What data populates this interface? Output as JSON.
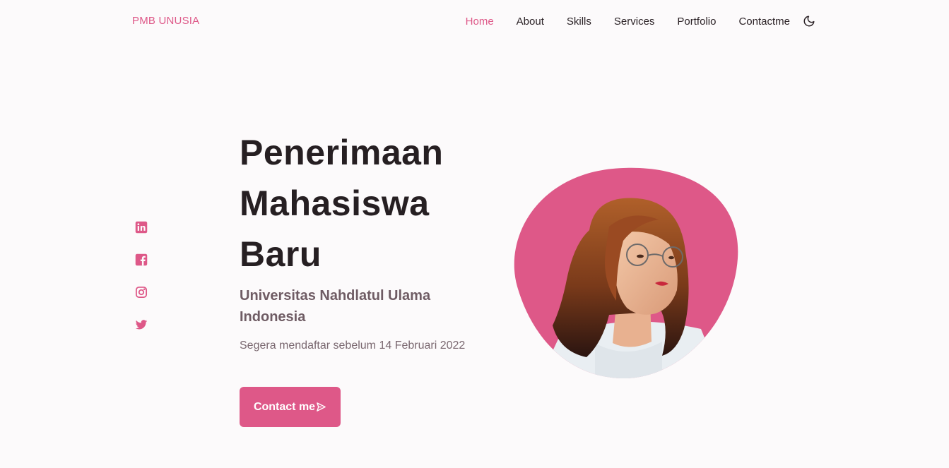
{
  "header": {
    "logo": "PMB UNUSIA",
    "nav": [
      {
        "label": "Home",
        "active": true
      },
      {
        "label": "About",
        "active": false
      },
      {
        "label": "Skills",
        "active": false
      },
      {
        "label": "Services",
        "active": false
      },
      {
        "label": "Portfolio",
        "active": false
      },
      {
        "label": "Contactme",
        "active": false
      }
    ],
    "theme_icon": "moon-icon"
  },
  "social": [
    {
      "icon": "linkedin-icon"
    },
    {
      "icon": "facebook-icon"
    },
    {
      "icon": "instagram-icon"
    },
    {
      "icon": "twitter-icon"
    }
  ],
  "hero": {
    "title_line1": "Penerimaan",
    "title_line2": "Mahasiswa",
    "title_line3": "Baru",
    "subtitle": "Universitas Nahdlatul Ulama Indonesia",
    "description": "Segera mendaftar sebelum 14 Februari 2022",
    "button_label": "Contact me",
    "button_icon": "send-icon"
  },
  "colors": {
    "accent": "#de5888",
    "background": "#fcfafb",
    "text": "#261f22"
  }
}
